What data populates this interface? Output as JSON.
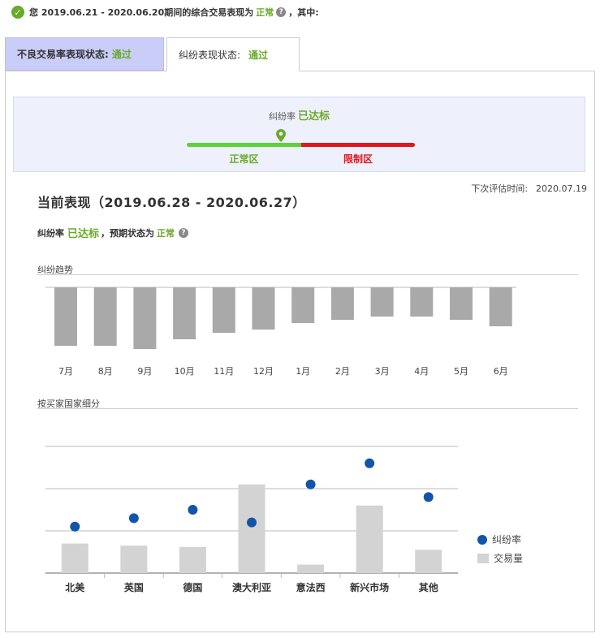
{
  "summary": {
    "prefix": "您 2019.06.21 - 2020.06.20期间的综合交易表现为",
    "status": "正常",
    "suffix": "，其中:"
  },
  "tabs": [
    {
      "label": "不良交易率表现状态:",
      "status": "通过"
    },
    {
      "label": "纠纷表现状态:",
      "status": "通过"
    }
  ],
  "status_box": {
    "label": "纠纷率",
    "status": "已达标",
    "zone_normal": "正常区",
    "zone_limit": "限制区"
  },
  "next_eval": {
    "label": "下次评估时间:",
    "date": "2020.07.19"
  },
  "current": {
    "title": "当前表现（2019.06.28 - 2020.06.27）",
    "rate_label": "纠纷率",
    "rate_status": "已达标",
    "mid": "，预期状态为",
    "expected_status": "正常"
  },
  "trend_label": "纠纷趋势",
  "country_label": "按买家国家细分",
  "legend": {
    "rate": "纠纷率",
    "volume": "交易量"
  },
  "colors": {
    "green": "#6aaa2a",
    "red": "#e2161d",
    "blue": "#1155a8",
    "bar_dark": "#a9a9a9",
    "bar_light": "#d3d3d3"
  },
  "chart_data": [
    {
      "type": "bar",
      "categories": [
        "7月",
        "8月",
        "9月",
        "10月",
        "11月",
        "12月",
        "1月",
        "2月",
        "3月",
        "4月",
        "5月",
        "6月"
      ],
      "values": [
        0.9,
        0.9,
        0.95,
        0.8,
        0.7,
        0.65,
        0.55,
        0.5,
        0.45,
        0.45,
        0.5,
        0.6
      ]
    },
    {
      "type": "bar",
      "categories": [
        "北美",
        "英国",
        "德国",
        "澳大利亚",
        "意法西",
        "新兴市场",
        "其他"
      ],
      "series": [
        {
          "name": "纠纷率",
          "type": "scatter",
          "values": [
            1.1,
            1.3,
            1.5,
            1.2,
            2.1,
            2.6,
            1.8
          ]
        },
        {
          "name": "交易量",
          "type": "bar",
          "values": [
            0.7,
            0.65,
            0.62,
            2.1,
            0.2,
            1.6,
            0.55
          ]
        }
      ],
      "ylim": [
        0,
        3
      ]
    }
  ]
}
